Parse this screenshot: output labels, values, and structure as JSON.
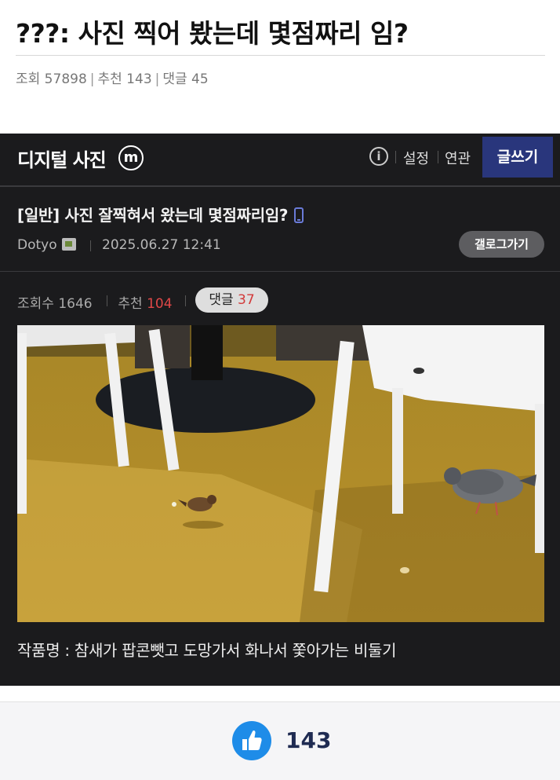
{
  "outer": {
    "title": "???: 사진 찍어 봤는데 몇점짜리 임?",
    "views": "조회 57898",
    "recommend": "추천 143",
    "comments": "댓글 45",
    "sep": "|"
  },
  "gallery": {
    "name": "디지털 사진",
    "minor_badge": "m",
    "info_icon_glyph": "i",
    "settings": "설정",
    "related": "연관",
    "write": "글쓰기"
  },
  "post": {
    "title": "[일반] 사진 잘찍혀서 왔는데 몇점짜리임?",
    "author": "Dotyo",
    "date": "2025.06.27 12:41",
    "gallog_button": "갤로그가기",
    "views_label": "조회수 1646",
    "recommend_label": "추천",
    "recommend_value": "104",
    "comment_label": "댓글",
    "comment_value": "37",
    "caption": "작품명 : 참새가 팝콘뺏고 도망가서 화나서 쫓아가는 비둘기"
  },
  "footer": {
    "like_count": "143"
  },
  "colors": {
    "header_bg": "#1b1b1d",
    "write_button": "#29367c",
    "like_blue": "#1e8ce8",
    "recommend_red": "#e04848"
  }
}
